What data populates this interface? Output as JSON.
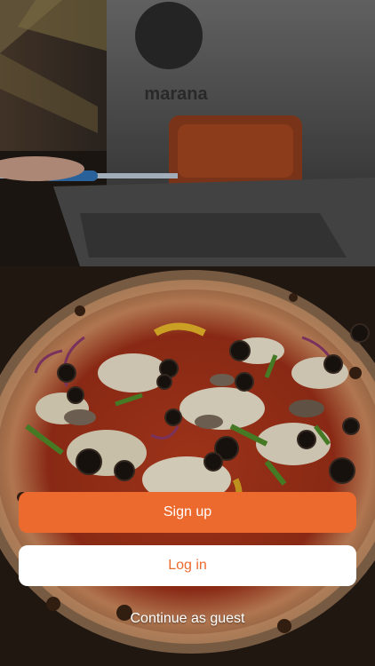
{
  "background": {
    "oven_brand": "marana"
  },
  "actions": {
    "sign_up_label": "Sign up",
    "log_in_label": "Log in",
    "guest_label": "Continue as guest"
  },
  "colors": {
    "accent": "#ed6a2e",
    "secondary_bg": "#ffffff",
    "text_light": "#ffffff"
  }
}
